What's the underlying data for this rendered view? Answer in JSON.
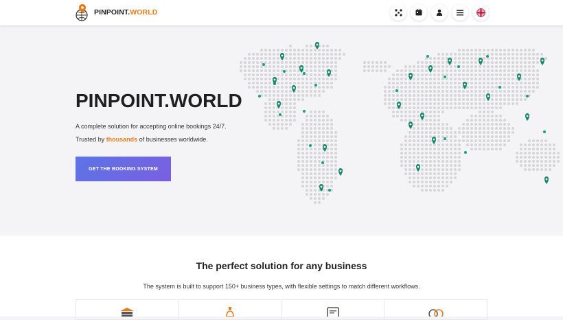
{
  "brand": {
    "name": "PINPOINT.",
    "name_accent": "WORLD"
  },
  "header": {
    "icons": [
      "tools-icon",
      "calendar-icon",
      "user-icon",
      "menu-icon",
      "uk-flag-icon"
    ]
  },
  "hero": {
    "title": "PINPOINT.WORLD",
    "tagline": "A complete solution for accepting online bookings 24/7.",
    "trust_prefix": "Trusted by ",
    "trust_highlight": "thousands",
    "trust_suffix": " of businesses worldwide.",
    "cta_label": "GET THE BOOKING SYSTEM"
  },
  "section": {
    "title": "The perfect solution for any business",
    "description": "The system is built to support 150+ business types, with flexible settings to match different workflows."
  },
  "cards": [
    "bank-icon",
    "bottle-icon",
    "document-icon",
    "rings-icon"
  ],
  "colors": {
    "accent": "#e77b1b",
    "cta_start": "#5c74e6",
    "cta_end": "#7b5fe0",
    "pin": "#12a37b"
  }
}
